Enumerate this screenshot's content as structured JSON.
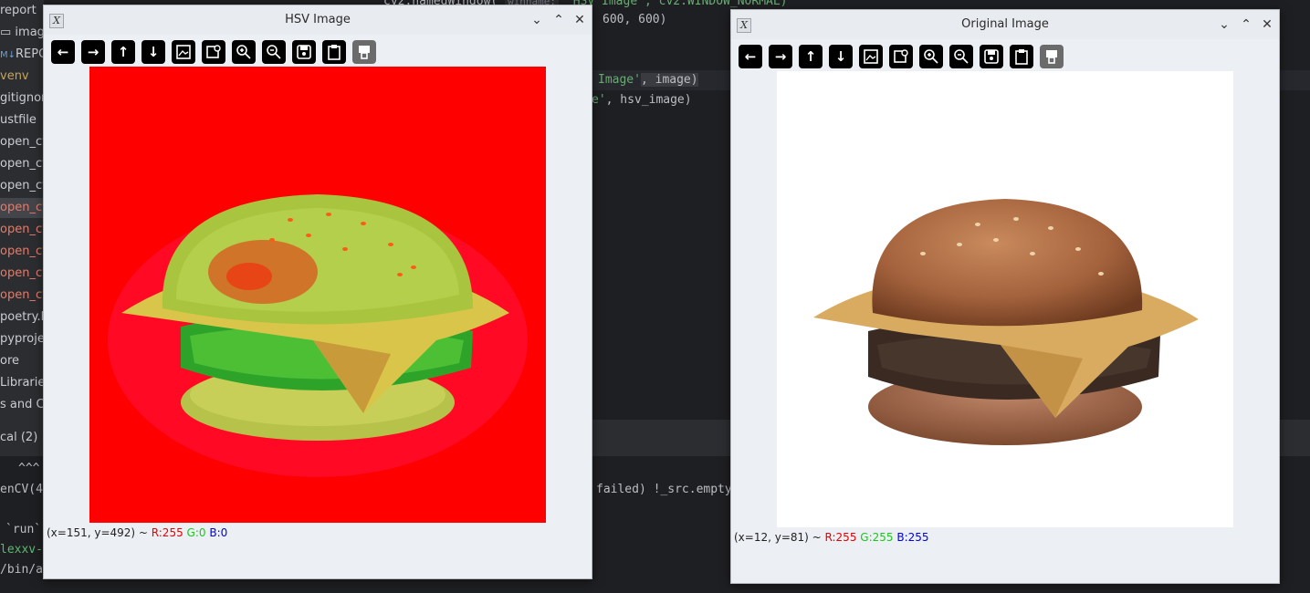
{
  "ide": {
    "sidebar_items": [
      "report",
      "imag",
      "REPO",
      "venv",
      "gitignor",
      "ustfile",
      "open_cv",
      "open_cv",
      "open_cv",
      "open_cv",
      "open_cv",
      "open_cv",
      "open_cv",
      "open_cv",
      "poetry.l",
      "pyproje",
      "ore",
      "Libraries",
      "s and Co"
    ],
    "sidebar_md_badge": "M↓",
    "code_line1_a": "cv2.namedWindow(",
    "code_line1_hint": "winname:",
    "code_line1_b": "'HSV Image', cv2.WINDOW_NORMAL)",
    "code_line2": "600, 600)",
    "code_line3_str": "Image'",
    "code_line3_rest": ", image)",
    "code_line4_str": "e'",
    "code_line4_rest": ", hsv_image)",
    "tab_label": "cal (2)",
    "term_line1": "^^^",
    "term_line2a": "enCV(4",
    "term_line2b": "failed) !_src.empty",
    "term_line3": "`run`",
    "term_line4": "lexxv-",
    "term_line5": "/bin/ac"
  },
  "hsv_window": {
    "title": "HSV Image",
    "status_coords": "(x=151, y=492) ~ ",
    "r_label": "R:255",
    "g_label": "G:0",
    "b_label": "B:0"
  },
  "original_window": {
    "title": "Original Image",
    "status_coords": "(x=12, y=81) ~ ",
    "r_label": "R:255",
    "g_label": "G:255",
    "b_label": "B:255"
  },
  "window_buttons": {
    "minimize": "⌄",
    "maximize": "⌃",
    "close": "✕"
  },
  "toolbar_icons": [
    "arrow-left-icon",
    "arrow-right-icon",
    "arrow-up-icon",
    "arrow-down-icon",
    "fit-image-icon",
    "image-search-icon",
    "zoom-in-icon",
    "zoom-out-icon",
    "save-icon",
    "clipboard-icon",
    "properties-icon"
  ],
  "colors": {
    "hsv_background": "#ff0000",
    "original_background": "#ffffff",
    "status_red": "#e60000",
    "status_green": "#19c919",
    "status_blue": "#0000e0"
  }
}
